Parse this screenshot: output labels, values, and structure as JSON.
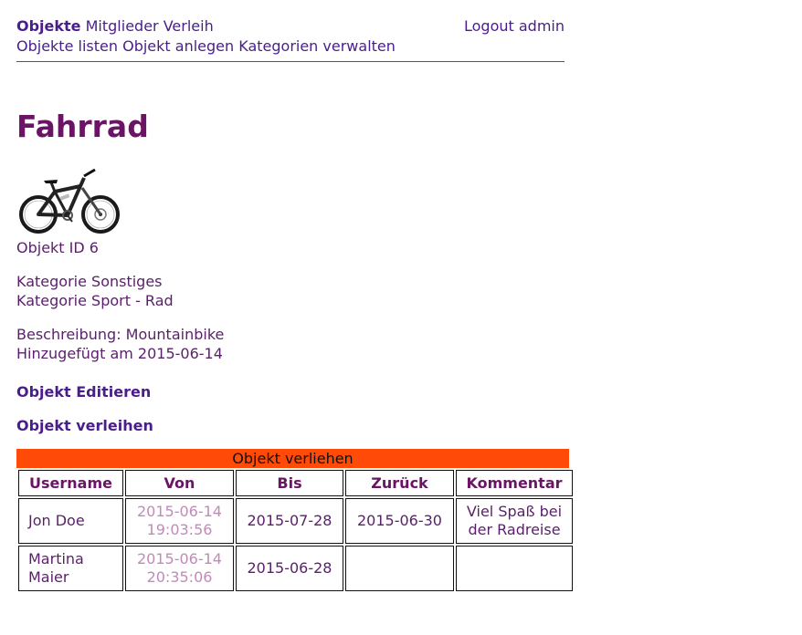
{
  "nav": {
    "objekte": "Objekte",
    "mitglieder": "Mitglieder",
    "verleih": "Verleih",
    "logout": "Logout admin",
    "sub": [
      "Objekte listen",
      "Objekt anlegen",
      "Kategorien verwalten"
    ]
  },
  "object": {
    "title": "Fahrrad",
    "id_line": "Objekt ID 6",
    "categories": [
      "Kategorie Sonstiges",
      "Kategorie Sport - Rad"
    ],
    "description": "Beschreibung: Mountainbike",
    "added": "Hinzugefügt am 2015-06-14",
    "image": "mountain-bike-photo"
  },
  "actions": {
    "edit": "Objekt Editieren",
    "lend": "Objekt verleihen"
  },
  "loans": {
    "caption": "Objekt verliehen",
    "headers": [
      "Username",
      "Von",
      "Bis",
      "Zurück",
      "Kommentar"
    ],
    "rows": [
      {
        "username": "Jon Doe",
        "von": "2015-06-14 19:03:56",
        "bis": "2015-07-28",
        "zurueck": "2015-06-30",
        "kommentar": "Viel Spaß bei der Radreise"
      },
      {
        "username": "Martina Maier",
        "von": "2015-06-14 20:35:06",
        "bis": "2015-06-28",
        "zurueck": "",
        "kommentar": ""
      }
    ]
  },
  "colors": {
    "link": "#4a1d8c",
    "text": "#5a1f6b",
    "title": "#6b1466",
    "loan_header_bg": "#ff4a08",
    "faded_date": "#c08bb8"
  }
}
